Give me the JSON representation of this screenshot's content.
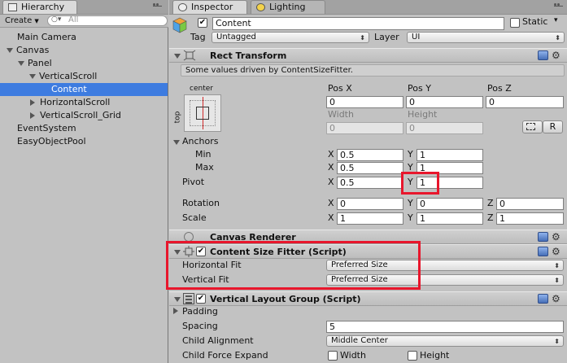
{
  "hierarchy": {
    "tab_label": "Hierarchy",
    "create_label": "Create",
    "search_placeholder": "All",
    "items": [
      {
        "label": "Main Camera",
        "depth": 0
      },
      {
        "label": "Canvas",
        "depth": 0
      },
      {
        "label": "Panel",
        "depth": 1
      },
      {
        "label": "VerticalScroll",
        "depth": 2
      },
      {
        "label": "Content",
        "depth": 3,
        "selected": true
      },
      {
        "label": "HorizontalScroll",
        "depth": 2
      },
      {
        "label": "VerticalScroll_Grid",
        "depth": 2
      },
      {
        "label": "EventSystem",
        "depth": 0
      },
      {
        "label": "EasyObjectPool",
        "depth": 0
      }
    ]
  },
  "inspector": {
    "tab_label": "Inspector",
    "lighting_tab_label": "Lighting",
    "object_name": "Content",
    "static_label": "Static",
    "tag_label": "Tag",
    "tag_value": "Untagged",
    "layer_label": "Layer",
    "layer_value": "UI",
    "rect_transform": {
      "title": "Rect Transform",
      "note": "Some values driven by ContentSizeFitter.",
      "anchor_preset": "center",
      "side_label": "top",
      "pos_x_label": "Pos X",
      "pos_y_label": "Pos Y",
      "pos_z_label": "Pos Z",
      "pos_x": "0",
      "pos_y": "0",
      "pos_z": "0",
      "width_label": "Width",
      "height_label": "Height",
      "width": "0",
      "height": "0",
      "blueprint_label": "",
      "raw_label": "R",
      "anchors_label": "Anchors",
      "min_label": "Min",
      "max_label": "Max",
      "min_x": "0.5",
      "min_y": "1",
      "max_x": "0.5",
      "max_y": "1",
      "pivot_label": "Pivot",
      "pivot_x": "0.5",
      "pivot_y": "1",
      "rotation_label": "Rotation",
      "rot_x": "0",
      "rot_y": "0",
      "rot_z": "0",
      "scale_label": "Scale",
      "scale_x": "1",
      "scale_y": "1",
      "scale_z": "1",
      "x": "X",
      "y": "Y",
      "z": "Z"
    },
    "canvas_renderer": {
      "title": "Canvas Renderer"
    },
    "content_size_fitter": {
      "title": "Content Size Fitter (Script)",
      "h_fit_label": "Horizontal Fit",
      "h_fit_value": "Preferred Size",
      "v_fit_label": "Vertical Fit",
      "v_fit_value": "Preferred Size"
    },
    "vertical_layout_group": {
      "title": "Vertical Layout Group (Script)",
      "padding_label": "Padding",
      "spacing_label": "Spacing",
      "spacing_value": "5",
      "child_alignment_label": "Child Alignment",
      "child_alignment_value": "Middle Center",
      "child_force_expand_label": "Child Force Expand",
      "width_label": "Width",
      "height_label": "Height"
    }
  },
  "colors": {
    "selection": "#3e7ce0",
    "highlight": "#e8162c",
    "panel_bg": "#c2c2c2"
  }
}
